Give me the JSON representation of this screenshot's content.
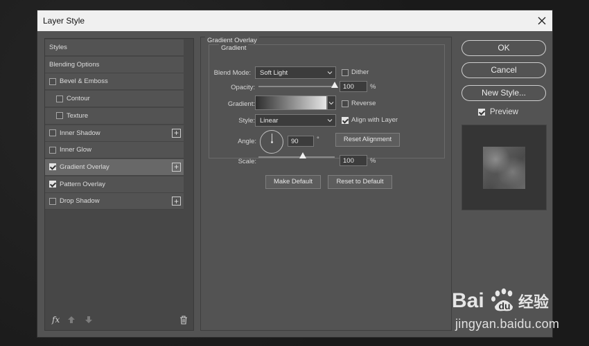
{
  "dialog": {
    "title": "Layer Style"
  },
  "styles_list": {
    "items": [
      {
        "label": "Styles",
        "checkbox": false,
        "checked": false,
        "plus": false,
        "indent": 0,
        "selected": false
      },
      {
        "label": "Blending Options",
        "checkbox": false,
        "checked": false,
        "plus": false,
        "indent": 0,
        "selected": false
      },
      {
        "label": "Bevel & Emboss",
        "checkbox": true,
        "checked": false,
        "plus": false,
        "indent": 0,
        "selected": false
      },
      {
        "label": "Contour",
        "checkbox": true,
        "checked": false,
        "plus": false,
        "indent": 1,
        "selected": false
      },
      {
        "label": "Texture",
        "checkbox": true,
        "checked": false,
        "plus": false,
        "indent": 1,
        "selected": false
      },
      {
        "label": "Inner Shadow",
        "checkbox": true,
        "checked": false,
        "plus": true,
        "indent": 0,
        "selected": false
      },
      {
        "label": "Inner Glow",
        "checkbox": true,
        "checked": false,
        "plus": false,
        "indent": 0,
        "selected": false
      },
      {
        "label": "Gradient Overlay",
        "checkbox": true,
        "checked": true,
        "plus": true,
        "indent": 0,
        "selected": true
      },
      {
        "label": "Pattern Overlay",
        "checkbox": true,
        "checked": true,
        "plus": false,
        "indent": 0,
        "selected": false
      },
      {
        "label": "Drop Shadow",
        "checkbox": true,
        "checked": false,
        "plus": true,
        "indent": 0,
        "selected": false
      }
    ],
    "footer": {
      "fx_label": "fx"
    }
  },
  "gradient_overlay": {
    "section_title": "Gradient Overlay",
    "group_title": "Gradient",
    "blend_mode": {
      "label": "Blend Mode:",
      "value": "Soft Light"
    },
    "dither": {
      "label": "Dither",
      "checked": false
    },
    "opacity": {
      "label": "Opacity:",
      "value": "100",
      "unit": "%",
      "fraction": 1.0
    },
    "gradient": {
      "label": "Gradient:"
    },
    "reverse": {
      "label": "Reverse",
      "checked": false
    },
    "style": {
      "label": "Style:",
      "value": "Linear"
    },
    "align_with_layer": {
      "label": "Align with Layer",
      "checked": true
    },
    "angle": {
      "label": "Angle:",
      "value": "90",
      "unit": "°"
    },
    "reset_alignment": {
      "label": "Reset Alignment"
    },
    "scale": {
      "label": "Scale:",
      "value": "100",
      "unit": "%",
      "fraction": 0.58
    },
    "make_default": {
      "label": "Make Default"
    },
    "reset_to_default": {
      "label": "Reset to Default"
    }
  },
  "actions": {
    "ok": "OK",
    "cancel": "Cancel",
    "new_style": "New Style...",
    "preview": {
      "label": "Preview",
      "checked": true
    }
  },
  "watermark": {
    "logo": "Baidu 经验",
    "url": "jingyan.baidu.com"
  }
}
